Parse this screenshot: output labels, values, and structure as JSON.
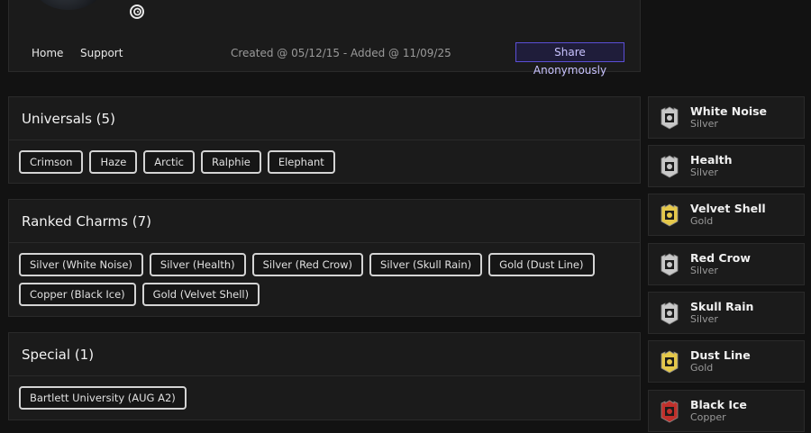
{
  "profile": {
    "top_right_text": "— — — — —",
    "nav": {
      "home": "Home",
      "support": "Support"
    },
    "meta": "Created @ 05/12/15 - Added @ 11/09/25",
    "share_label": "Share Anonymously"
  },
  "sections": {
    "universals": {
      "title": "Universals (5)",
      "items": [
        "Crimson",
        "Haze",
        "Arctic",
        "Ralphie",
        "Elephant"
      ]
    },
    "ranked": {
      "title": "Ranked Charms (7)",
      "items": [
        "Silver (White Noise)",
        "Silver (Health)",
        "Silver (Red Crow)",
        "Silver (Skull Rain)",
        "Gold (Dust Line)",
        "Copper (Black Ice)",
        "Gold (Velvet Shell)"
      ]
    },
    "special": {
      "title": "Special (1)",
      "items": [
        "Bartlett University (AUG A2)"
      ]
    }
  },
  "charms": [
    {
      "name": "White Noise",
      "tier": "Silver",
      "icon": "silver-charm-icon",
      "color": "#c8c8c8"
    },
    {
      "name": "Health",
      "tier": "Silver",
      "icon": "silver-charm-icon",
      "color": "#c8c8c8"
    },
    {
      "name": "Velvet Shell",
      "tier": "Gold",
      "icon": "gold-charm-icon",
      "color": "#e5c84a"
    },
    {
      "name": "Red Crow",
      "tier": "Silver",
      "icon": "silver-charm-icon",
      "color": "#c8c8c8"
    },
    {
      "name": "Skull Rain",
      "tier": "Silver",
      "icon": "silver-charm-icon",
      "color": "#c8c8c8"
    },
    {
      "name": "Dust Line",
      "tier": "Gold",
      "icon": "gold-charm-icon",
      "color": "#e5c84a"
    },
    {
      "name": "Black Ice",
      "tier": "Copper",
      "icon": "copper-charm-icon",
      "color": "#c0302b"
    }
  ],
  "colors": {
    "accent": "#5b4fd6",
    "background": "#121212",
    "card": "#1b1b1b"
  }
}
